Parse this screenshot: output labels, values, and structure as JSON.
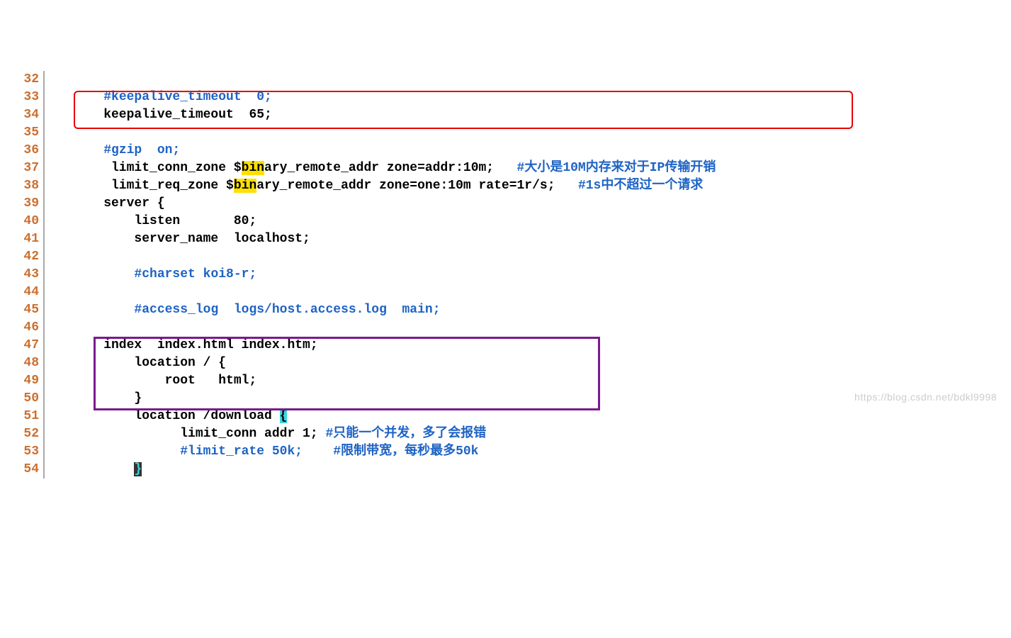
{
  "watermark": "https://blog.csdn.net/bdkl9998",
  "lines": [
    {
      "num": "32",
      "segments": []
    },
    {
      "num": "33",
      "segments": [
        {
          "text": "    ",
          "cls": ""
        },
        {
          "text": "#keepalive_timeout  0;",
          "cls": "cmt"
        }
      ]
    },
    {
      "num": "34",
      "segments": [
        {
          "text": "    keepalive_timeout  65;",
          "cls": ""
        }
      ]
    },
    {
      "num": "35",
      "segments": []
    },
    {
      "num": "36",
      "segments": [
        {
          "text": "    ",
          "cls": ""
        },
        {
          "text": "#gzip  on;",
          "cls": "cmt"
        }
      ]
    },
    {
      "num": "37",
      "segments": [
        {
          "text": "     limit_conn_zone $",
          "cls": ""
        },
        {
          "text": "bin",
          "cls": "hl"
        },
        {
          "text": "ary_remote_addr zone=addr:10m;   ",
          "cls": ""
        },
        {
          "text": "#大小是10M内存来对于IP传输开销",
          "cls": "cmt"
        }
      ]
    },
    {
      "num": "38",
      "segments": [
        {
          "text": "     limit_req_zone $",
          "cls": ""
        },
        {
          "text": "bin",
          "cls": "hl"
        },
        {
          "text": "ary_remote_addr zone=one:10m rate=1r/s;   ",
          "cls": ""
        },
        {
          "text": "#1s中不超过一个请求",
          "cls": "cmt"
        }
      ]
    },
    {
      "num": "39",
      "segments": [
        {
          "text": "    server {",
          "cls": ""
        }
      ]
    },
    {
      "num": "40",
      "segments": [
        {
          "text": "        listen       80;",
          "cls": ""
        }
      ]
    },
    {
      "num": "41",
      "segments": [
        {
          "text": "        server_name  localhost;",
          "cls": ""
        }
      ]
    },
    {
      "num": "42",
      "segments": []
    },
    {
      "num": "43",
      "segments": [
        {
          "text": "        ",
          "cls": ""
        },
        {
          "text": "#charset koi8-r;",
          "cls": "cmt"
        }
      ]
    },
    {
      "num": "44",
      "segments": []
    },
    {
      "num": "45",
      "segments": [
        {
          "text": "        ",
          "cls": ""
        },
        {
          "text": "#access_log  logs/host.access.log  main;",
          "cls": "cmt"
        }
      ]
    },
    {
      "num": "46",
      "segments": []
    },
    {
      "num": "47",
      "segments": [
        {
          "text": "    index  index.html index.htm;",
          "cls": ""
        }
      ]
    },
    {
      "num": "48",
      "segments": [
        {
          "text": "        location / {",
          "cls": ""
        }
      ]
    },
    {
      "num": "49",
      "segments": [
        {
          "text": "            root   html;",
          "cls": ""
        }
      ]
    },
    {
      "num": "50",
      "segments": [
        {
          "text": "        }",
          "cls": ""
        }
      ]
    },
    {
      "num": "51",
      "segments": [
        {
          "text": "        location /download ",
          "cls": ""
        },
        {
          "text": "{",
          "cls": "hlbrace"
        }
      ]
    },
    {
      "num": "52",
      "segments": [
        {
          "text": "              limit_conn addr 1; ",
          "cls": ""
        },
        {
          "text": "#只能一个并发，多了会报错",
          "cls": "cmt"
        }
      ]
    },
    {
      "num": "53",
      "segments": [
        {
          "text": "              ",
          "cls": ""
        },
        {
          "text": "#limit_rate 50k;    #限制带宽，每秒最多50k",
          "cls": "cmt"
        }
      ]
    },
    {
      "num": "54",
      "segments": [
        {
          "text": "        ",
          "cls": ""
        },
        {
          "text": "}",
          "cls": "hlbrace2"
        }
      ]
    }
  ]
}
